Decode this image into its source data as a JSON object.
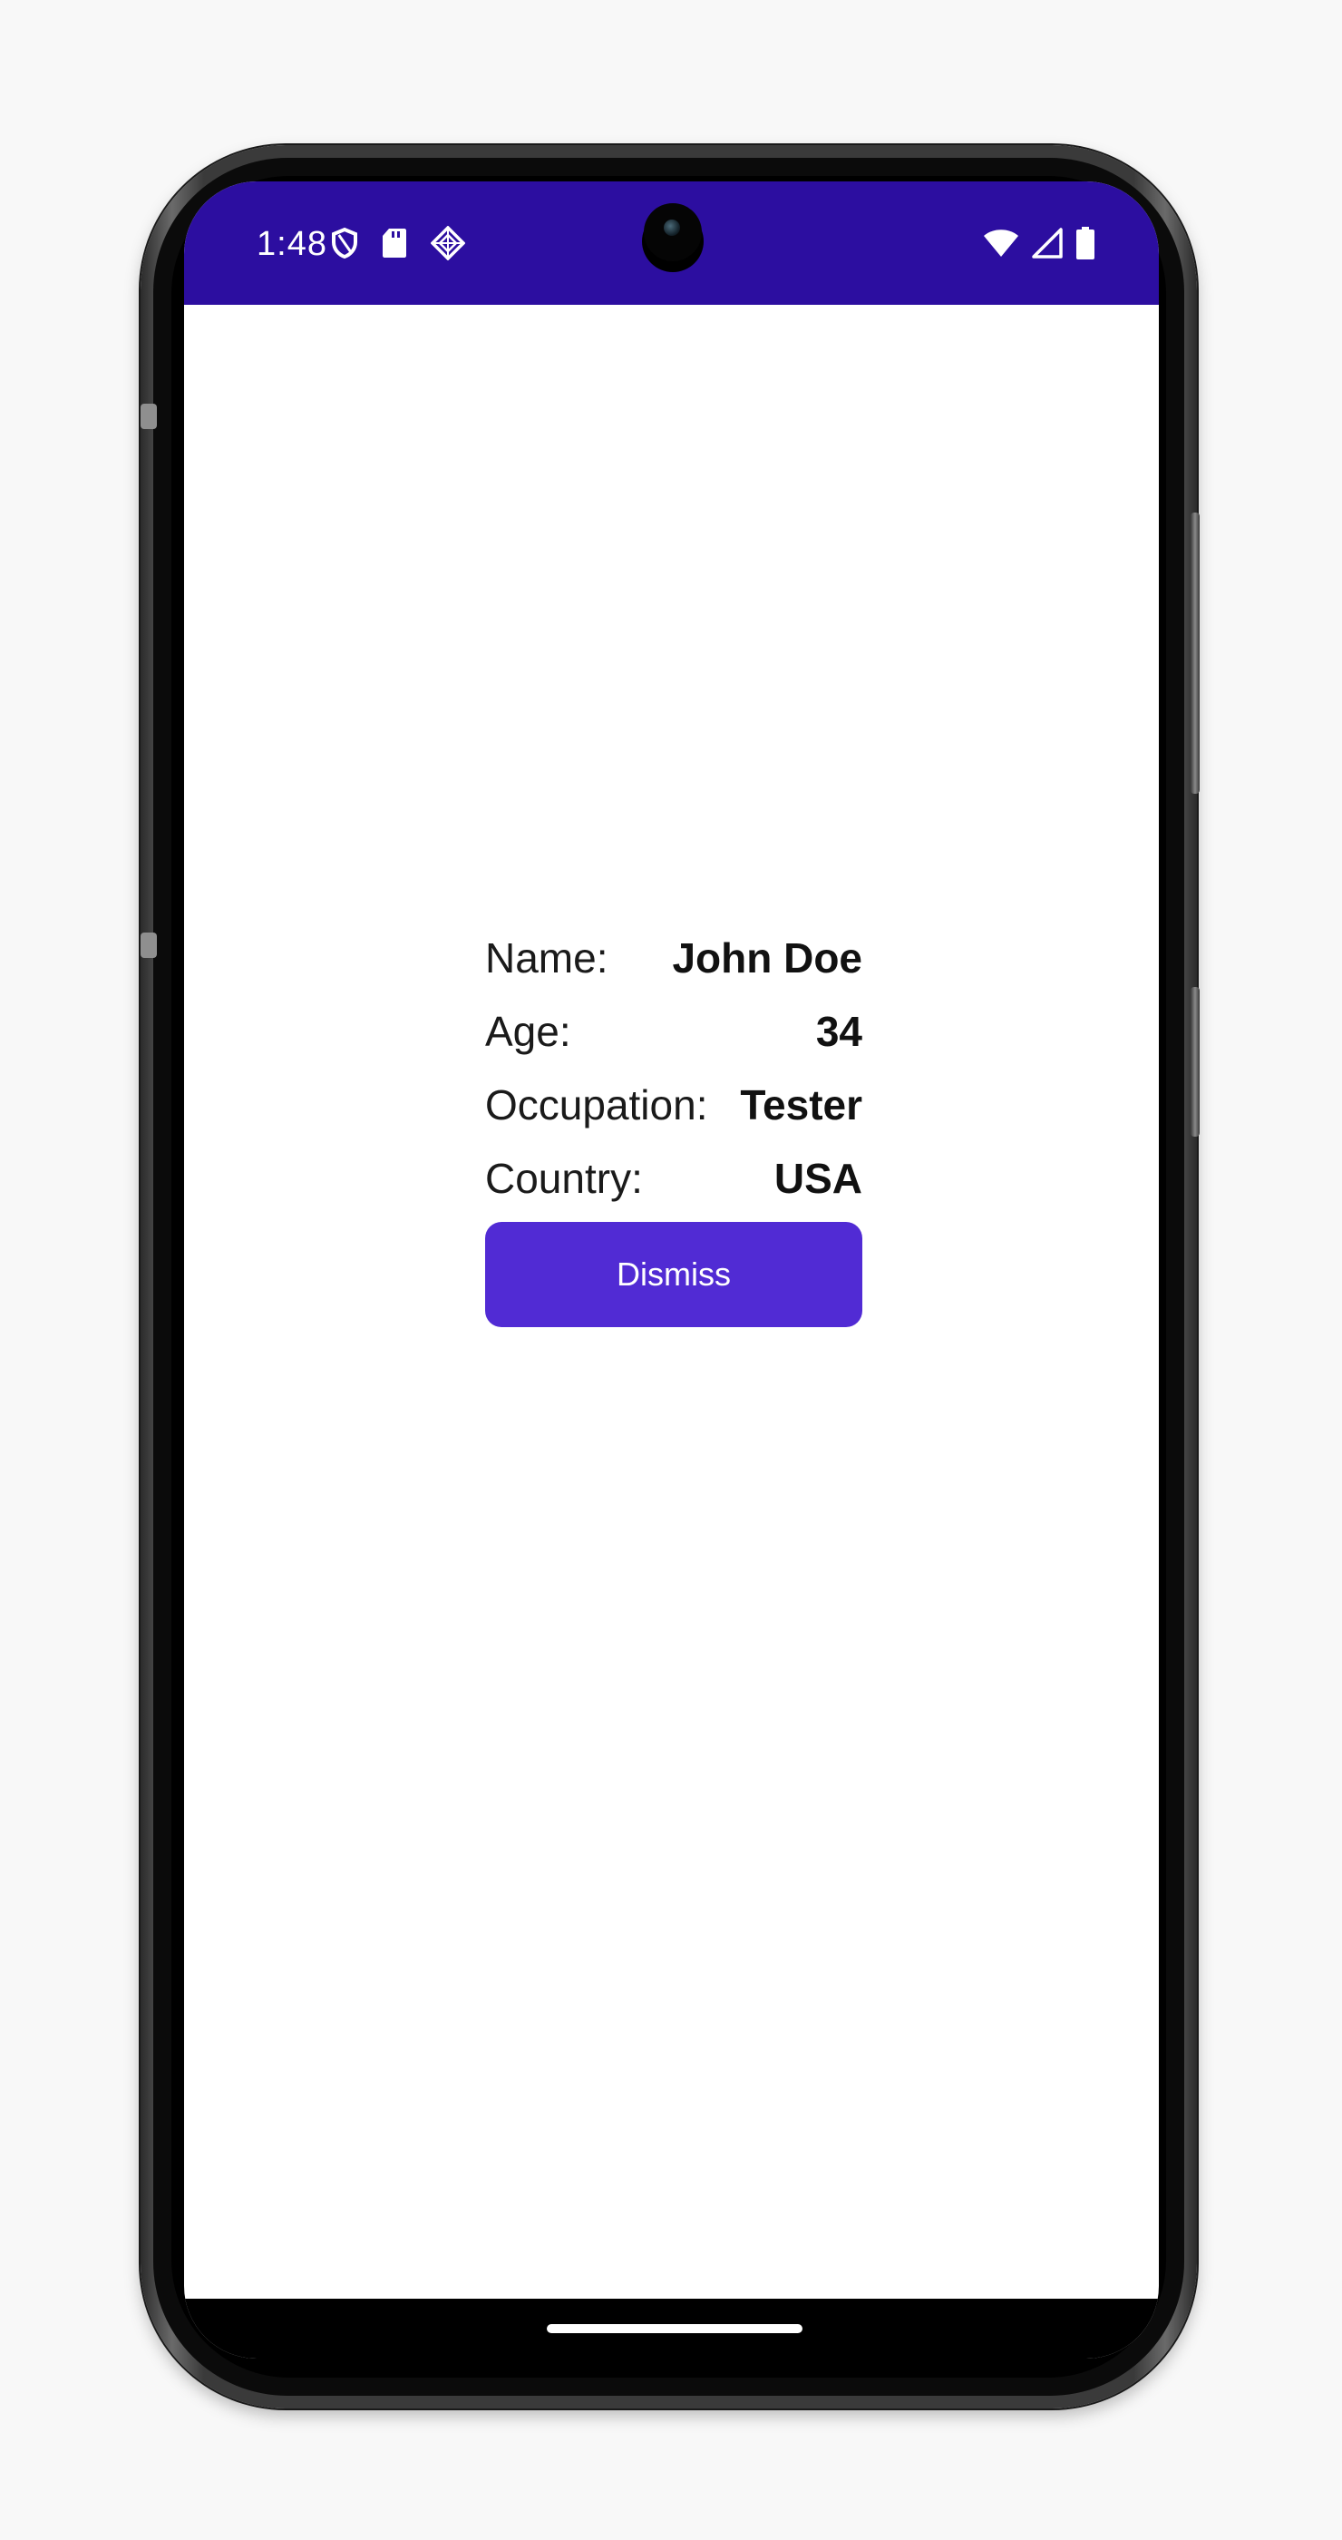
{
  "status_bar": {
    "time": "1:48",
    "background_color": "#2c0ea0",
    "left_icons": [
      "shield-icon",
      "sd-card-icon",
      "diamond-icon"
    ],
    "right_icons": [
      "wifi-icon",
      "cell-signal-icon",
      "battery-icon"
    ]
  },
  "details": {
    "rows": [
      {
        "label": "Name:",
        "value": "John Doe"
      },
      {
        "label": "Age:",
        "value": "34"
      },
      {
        "label": "Occupation:",
        "value": "Tester"
      },
      {
        "label": "Country:",
        "value": "USA"
      }
    ]
  },
  "dismiss_button": {
    "label": "Dismiss",
    "color": "#512bd4"
  }
}
